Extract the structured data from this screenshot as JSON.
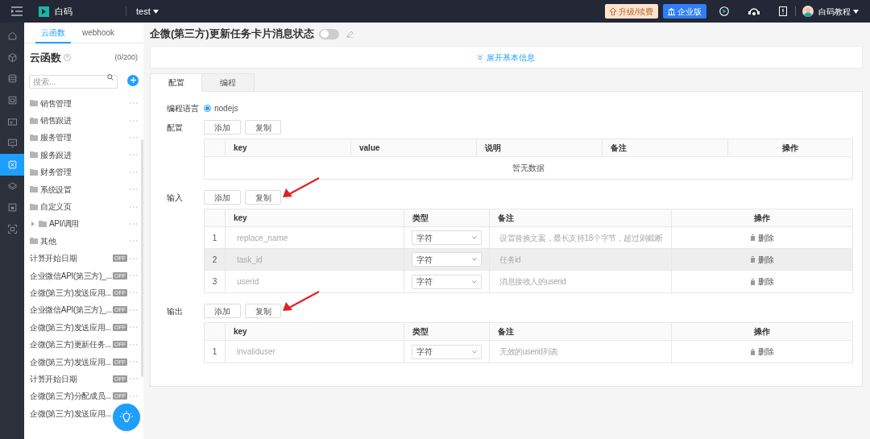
{
  "topbar": {
    "app_name": "白码",
    "project": "test",
    "upgrade_button": "升级/续费",
    "edition_button": "企业版",
    "user_name": "白码教程"
  },
  "rail": [
    {
      "selected": false
    },
    {
      "selected": false
    },
    {
      "selected": false
    },
    {
      "selected": false
    },
    {
      "selected": false
    },
    {
      "selected": false
    },
    {
      "selected": true
    },
    {
      "selected": false
    },
    {
      "selected": false
    },
    {
      "selected": false
    }
  ],
  "sidebar": {
    "tabs": [
      {
        "label": "云函数",
        "selected": true
      },
      {
        "label": "webhook",
        "selected": false
      }
    ],
    "title": "云函数",
    "count": "(0/200)",
    "search_placeholder": "搜索...",
    "items": [
      {
        "kind": "folder",
        "label": "销售管理"
      },
      {
        "kind": "folder",
        "label": "销售跟进"
      },
      {
        "kind": "folder",
        "label": "服务管理"
      },
      {
        "kind": "folder",
        "label": "服务跟进"
      },
      {
        "kind": "folder",
        "label": "财务管理"
      },
      {
        "kind": "folder",
        "label": "系统设置"
      },
      {
        "kind": "folder",
        "label": "自定义页"
      },
      {
        "kind": "folder",
        "label": "API/调用",
        "expanded": false
      },
      {
        "kind": "folder",
        "label": "其他"
      },
      {
        "kind": "function",
        "label": "计算开始日期",
        "badge": "OFF"
      },
      {
        "kind": "function",
        "label": "企业微信API(第三方)_...",
        "badge": "OFF"
      },
      {
        "kind": "function",
        "label": "企微(第三方)发送应用...",
        "badge": "OFF"
      },
      {
        "kind": "function",
        "label": "企业微信API(第三方)_...",
        "badge": "OFF"
      },
      {
        "kind": "function",
        "label": "企微(第三方)发送应用...",
        "badge": "OFF"
      },
      {
        "kind": "function",
        "label": "企微(第三方)更新任务...",
        "badge": "OFF"
      },
      {
        "kind": "function",
        "label": "企微(第三方)发送应用...",
        "badge": "OFF"
      },
      {
        "kind": "function",
        "label": "计算开始日期",
        "badge": "OFF"
      },
      {
        "kind": "function",
        "label": "企微(第三方)分配成员...",
        "badge": "OFF"
      },
      {
        "kind": "function",
        "label": "企微(第三方)发送应用..."
      }
    ]
  },
  "page": {
    "title": "企微(第三方)更新任务卡片消息状态",
    "enabled": false,
    "expand_link": "展开基本信息",
    "tabs": [
      {
        "label": "配置",
        "selected": true
      },
      {
        "label": "编程",
        "selected": false
      }
    ],
    "language_label": "编程语言",
    "language": {
      "label": "nodejs",
      "selected": true
    },
    "sections": [
      {
        "label": "配置",
        "add_button": "添加",
        "copy_button": "复制",
        "columns": [
          "key",
          "value",
          "说明",
          "备注",
          "操作"
        ],
        "empty_text": "暂无数据"
      },
      {
        "label": "输入",
        "add_button": "添加",
        "copy_button": "复制",
        "arrow": true,
        "columns": [
          "key",
          "类型",
          "备注",
          "操作"
        ],
        "rows": [
          {
            "index": "1",
            "key": "replace_name",
            "type": "字符",
            "note": "设置替换文案，最长支持18个字节，超过则截断",
            "action": "删除",
            "highlighted": false
          },
          {
            "index": "2",
            "key": "task_id",
            "type": "字符",
            "note": "任务id",
            "action": "删除",
            "highlighted": true
          },
          {
            "index": "3",
            "key": "userid",
            "type": "字符",
            "note": "消息接收人的userid",
            "action": "删除",
            "highlighted": false
          }
        ]
      },
      {
        "label": "输出",
        "add_button": "添加",
        "copy_button": "复制",
        "arrow": true,
        "columns": [
          "key",
          "类型",
          "备注",
          "操作"
        ],
        "rows": [
          {
            "index": "1",
            "key": "invaliduser",
            "type": "字符",
            "note": "无效的userid列表",
            "action": "删除",
            "highlighted": false
          }
        ]
      }
    ]
  }
}
